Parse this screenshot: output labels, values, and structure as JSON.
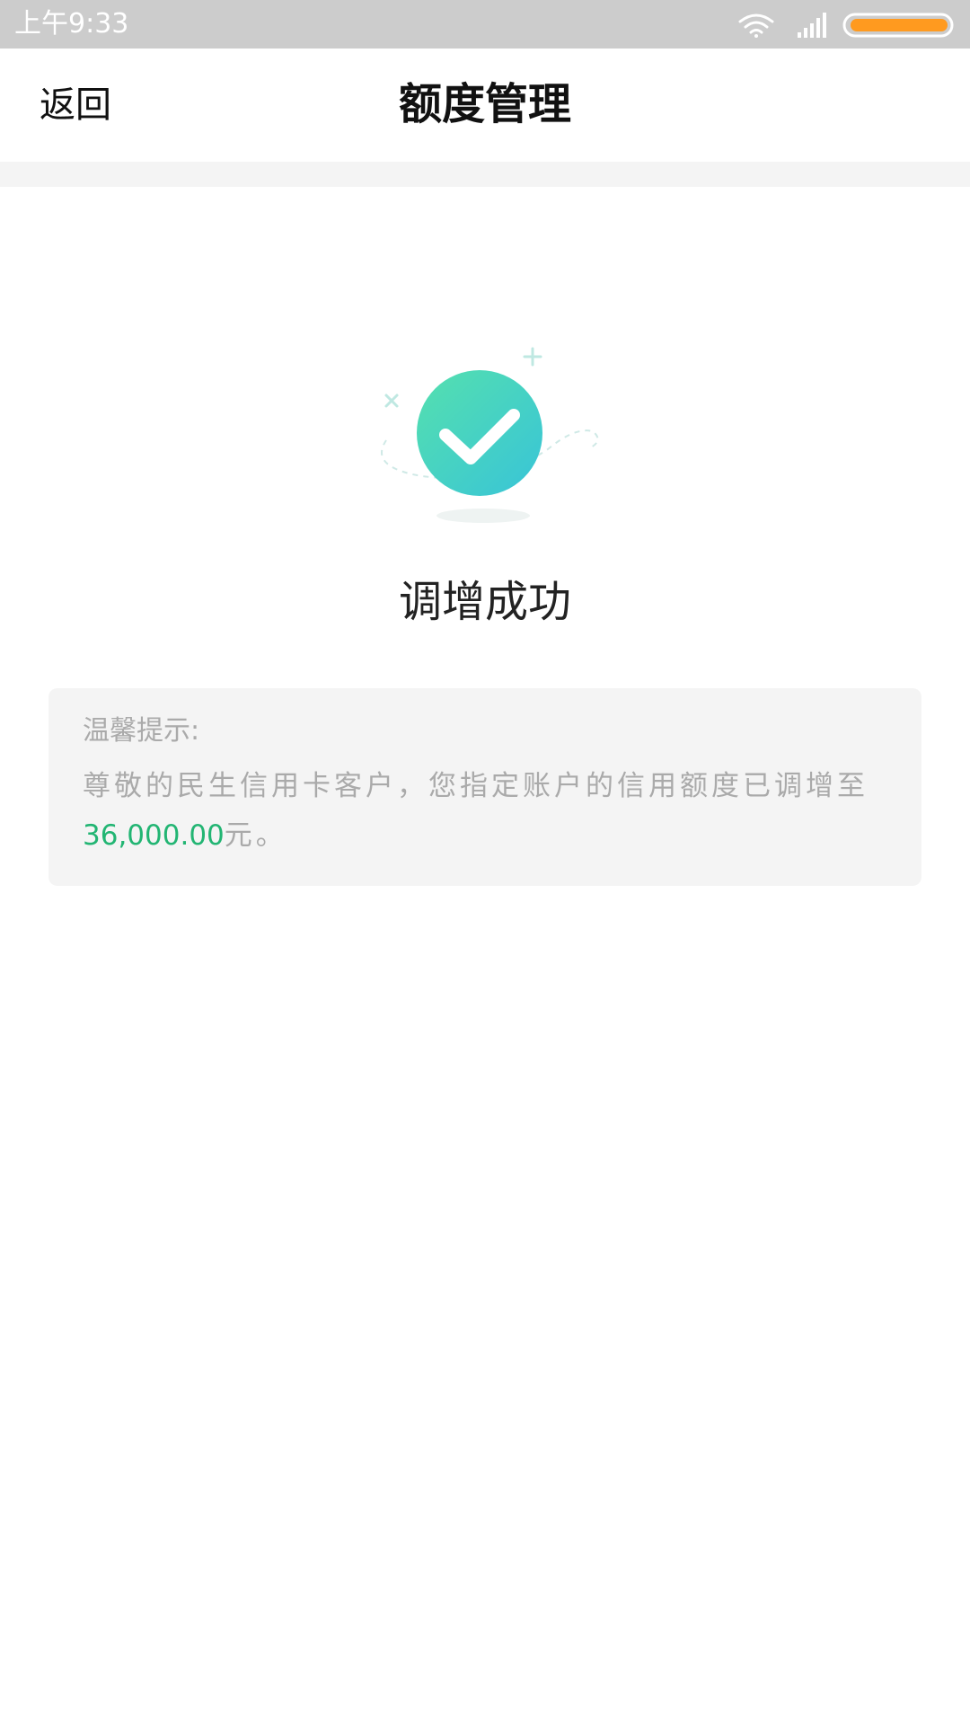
{
  "status_bar": {
    "time": "上午9:33",
    "icons": [
      "wifi-icon",
      "signal-icon",
      "battery-icon"
    ],
    "battery_color": "#ff9a1f"
  },
  "nav": {
    "back_label": "返回",
    "title": "额度管理"
  },
  "result": {
    "icon": "success-check-icon",
    "title": "调增成功",
    "icon_gradient": [
      "#4fe0b0",
      "#3ec5d6"
    ]
  },
  "tip": {
    "heading": "温馨提示:",
    "body_prefix": "尊敬的民生信用卡客户，您指定账户的信用额度已调增至",
    "amount": "36,000.00",
    "body_suffix": "元。",
    "amount_color": "#22b573"
  }
}
